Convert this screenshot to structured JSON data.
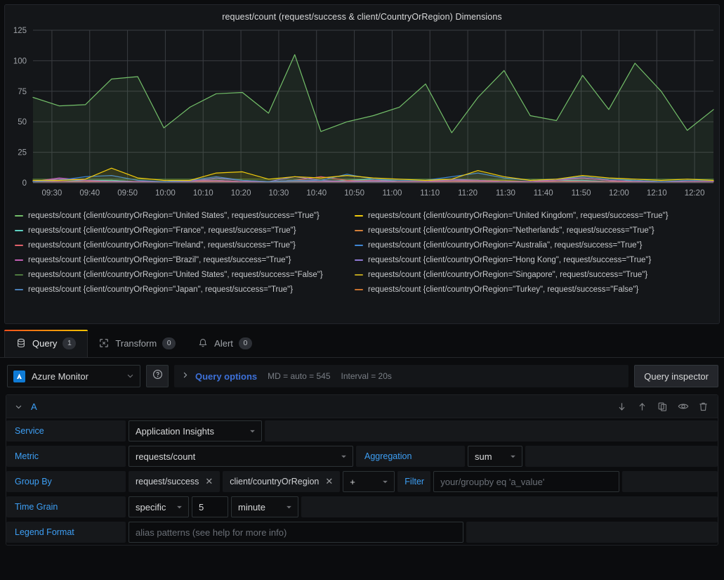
{
  "panel": {
    "title": "request/count (request/success & client/CountryOrRegion) Dimensions"
  },
  "chart_data": {
    "type": "area",
    "title": "request/count (request/success & client/CountryOrRegion) Dimensions",
    "xlabel": "",
    "ylabel": "",
    "ylim": [
      0,
      125
    ],
    "yticks": [
      "0",
      "25",
      "50",
      "75",
      "100",
      "125"
    ],
    "xticks": [
      "09:30",
      "09:40",
      "09:50",
      "10:00",
      "10:10",
      "10:20",
      "10:30",
      "10:40",
      "10:50",
      "11:00",
      "11:10",
      "11:20",
      "11:30",
      "11:40",
      "11:50",
      "12:00",
      "12:10",
      "12:20"
    ],
    "grid": true,
    "legend_position": "bottom",
    "x": [
      "09:25",
      "09:30",
      "09:35",
      "09:40",
      "09:45",
      "09:50",
      "09:55",
      "10:00",
      "10:05",
      "10:10",
      "10:15",
      "10:20",
      "10:25",
      "10:30",
      "10:35",
      "10:40",
      "10:45",
      "10:50",
      "10:55",
      "11:00",
      "11:05",
      "11:10",
      "11:15",
      "11:20",
      "11:25",
      "11:30",
      "11:35",
      "11:40",
      "11:45",
      "11:50",
      "11:55",
      "12:00",
      "12:05",
      "12:10",
      "12:15"
    ],
    "series": [
      {
        "name": "requests/count {client/countryOrRegion=\"United States\", request/success=\"True\"}",
        "color": "#73bf69",
        "values": [
          70,
          63,
          64,
          85,
          87,
          45,
          62,
          73,
          74,
          57,
          105,
          42,
          50,
          55,
          62,
          81,
          41,
          70,
          92,
          55,
          51,
          88,
          60,
          98,
          75,
          43,
          60
        ]
      },
      {
        "name": "requests/count {client/countryOrRegion=\"United Kingdom\", request/success=\"True\"}",
        "color": "#f2cc0c",
        "values": [
          2,
          2,
          3,
          12,
          4,
          2,
          2,
          8,
          9,
          3,
          5,
          4,
          6,
          4,
          3,
          2,
          3,
          10,
          5,
          2,
          3,
          6,
          4,
          3,
          2,
          3,
          2
        ]
      },
      {
        "name": "requests/count {client/countryOrRegion=\"France\", request/success=\"True\"}",
        "color": "#5fd3c4",
        "values": [
          1,
          1,
          2,
          2,
          1,
          1,
          2,
          2,
          1,
          1,
          2,
          1,
          2,
          3,
          1,
          1,
          2,
          2,
          1,
          1,
          2,
          2,
          1,
          2,
          1,
          1,
          1
        ]
      },
      {
        "name": "requests/count {client/countryOrRegion=\"Netherlands\", request/success=\"True\"}",
        "color": "#d4803a",
        "values": [
          1,
          1,
          1,
          2,
          1,
          1,
          1,
          2,
          1,
          1,
          2,
          1,
          1,
          2,
          1,
          1,
          1,
          2,
          1,
          1,
          1,
          2,
          1,
          1,
          1,
          1,
          1
        ]
      },
      {
        "name": "requests/count {client/countryOrRegion=\"Ireland\", request/success=\"True\"}",
        "color": "#e0616a",
        "values": [
          1,
          1,
          1,
          1,
          1,
          1,
          1,
          1,
          1,
          1,
          2,
          5,
          2,
          1,
          1,
          1,
          1,
          1,
          1,
          1,
          1,
          1,
          1,
          1,
          1,
          1,
          1
        ]
      },
      {
        "name": "requests/count {client/countryOrRegion=\"Australia\", request/success=\"True\"}",
        "color": "#3f87d4",
        "values": [
          1,
          2,
          5,
          6,
          2,
          1,
          2,
          5,
          2,
          1,
          2,
          2,
          7,
          3,
          2,
          2,
          5,
          8,
          4,
          2,
          3,
          5,
          3,
          2,
          1,
          2,
          2
        ]
      },
      {
        "name": "requests/count {client/countryOrRegion=\"Brazil\", request/success=\"True\"}",
        "color": "#c25fb5",
        "values": [
          1,
          4,
          2,
          1,
          1,
          1,
          2,
          2,
          1,
          1,
          2,
          1,
          1,
          2,
          1,
          1,
          2,
          2,
          1,
          1,
          2,
          4,
          2,
          1,
          1,
          1,
          1
        ]
      },
      {
        "name": "requests/count {client/countryOrRegion=\"Hong Kong\", request/success=\"True\"}",
        "color": "#8f7ad4",
        "values": [
          1,
          3,
          2,
          1,
          1,
          1,
          1,
          4,
          2,
          1,
          5,
          2,
          1,
          1,
          1,
          1,
          3,
          2,
          1,
          1,
          3,
          4,
          2,
          1,
          1,
          1,
          1
        ]
      },
      {
        "name": "requests/count {client/countryOrRegion=\"United States\", request/success=\"False\"}",
        "color": "#4f7a3f",
        "values": [
          3,
          3,
          3,
          3,
          3,
          3,
          3,
          3,
          3,
          3,
          3,
          3,
          3,
          3,
          3,
          3,
          3,
          3,
          3,
          3,
          3,
          3,
          3,
          3,
          3,
          3,
          3
        ]
      },
      {
        "name": "requests/count {client/countryOrRegion=\"Singapore\", request/success=\"True\"}",
        "color": "#b8a01e",
        "values": [
          1,
          1,
          1,
          1,
          1,
          1,
          1,
          1,
          1,
          1,
          1,
          1,
          2,
          2,
          2,
          2,
          2,
          2,
          2,
          1,
          1,
          1,
          1,
          1,
          1,
          1,
          1
        ]
      },
      {
        "name": "requests/count {client/countryOrRegion=\"Japan\", request/success=\"True\"}",
        "color": "#4a7fb8",
        "values": [
          1,
          1,
          1,
          1,
          1,
          1,
          1,
          1,
          1,
          1,
          1,
          1,
          1,
          1,
          1,
          1,
          1,
          1,
          1,
          1,
          1,
          1,
          1,
          1,
          1,
          1,
          1
        ]
      },
      {
        "name": "requests/count {client/countryOrRegion=\"Turkey\", request/success=\"False\"}",
        "color": "#c8722e",
        "values": [
          1,
          1,
          1,
          1,
          1,
          1,
          1,
          1,
          1,
          1,
          1,
          1,
          1,
          1,
          1,
          1,
          1,
          1,
          1,
          1,
          1,
          1,
          1,
          1,
          1,
          1,
          1
        ]
      }
    ]
  },
  "tabs": [
    {
      "label": "Query",
      "count": "1",
      "icon": "database-icon",
      "active": true
    },
    {
      "label": "Transform",
      "count": "0",
      "icon": "transform-icon",
      "active": false
    },
    {
      "label": "Alert",
      "count": "0",
      "icon": "bell-icon",
      "active": false
    }
  ],
  "toolbar": {
    "datasource": "Azure Monitor",
    "help_icon": "help-circle-icon",
    "query_options_label": "Query options",
    "max_data_points": "MD = auto = 545",
    "interval": "Interval = 20s",
    "query_inspector_label": "Query inspector"
  },
  "query": {
    "ref_id": "A",
    "actions": [
      {
        "name": "move-query-down-button",
        "icon": "arrow-down-icon"
      },
      {
        "name": "move-query-up-button",
        "icon": "arrow-up-icon"
      },
      {
        "name": "duplicate-query-button",
        "icon": "copy-icon"
      },
      {
        "name": "toggle-query-visibility-button",
        "icon": "eye-icon"
      },
      {
        "name": "remove-query-button",
        "icon": "trash-icon"
      }
    ],
    "service": {
      "label": "Service",
      "value": "Application Insights"
    },
    "metric": {
      "label": "Metric",
      "value": "requests/count"
    },
    "aggregation": {
      "label": "Aggregation",
      "value": "sum"
    },
    "group_by": {
      "label": "Group By",
      "tags": [
        "request/success",
        "client/countryOrRegion"
      ],
      "add_label": "+"
    },
    "filter": {
      "label": "Filter",
      "value": "",
      "placeholder": "your/groupby eq 'a_value'"
    },
    "time_grain": {
      "label": "Time Grain",
      "mode": "specific",
      "amount": "5",
      "unit": "minute"
    },
    "legend_format": {
      "label": "Legend Format",
      "value": "",
      "placeholder": "alias patterns (see help for more info)"
    }
  },
  "colors": {
    "accent_blue": "#3d9ff5",
    "link_blue": "#3d71d9",
    "tab_active_gradient_start": "#f2511b",
    "tab_active_gradient_end": "#f2c200",
    "panel_bg": "#141619",
    "page_bg": "#0b0c0e"
  }
}
